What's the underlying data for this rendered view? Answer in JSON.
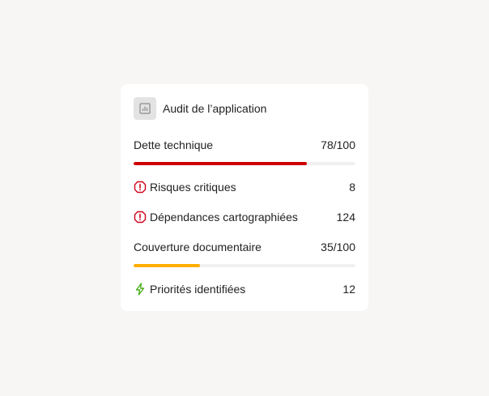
{
  "card": {
    "title": "Audit de l’application",
    "title_icon": "bar-chart-icon"
  },
  "metrics": {
    "dette": {
      "label": "Dette technique",
      "value": "78/100",
      "progress": 0.78,
      "color": "#cc0000"
    },
    "risques": {
      "label": "Risques critiques",
      "value": "8",
      "icon": "alert-octagon-icon",
      "icon_color": "#d0021b"
    },
    "dependances": {
      "label": "Dépendances cartographiées",
      "value": "124",
      "icon": "alert-octagon-icon",
      "icon_color": "#d0021b"
    },
    "couverture": {
      "label": "Couverture documentaire",
      "value": "35/100",
      "progress": 0.3,
      "color": "#ffae00"
    },
    "priorites": {
      "label": "Priorités identifiées",
      "value": "12",
      "icon": "lightning-bolt-icon",
      "icon_color": "#4caf1e"
    }
  },
  "colors": {
    "background": "#f7f6f4",
    "card": "#ffffff",
    "track": "#f1f1f1"
  }
}
